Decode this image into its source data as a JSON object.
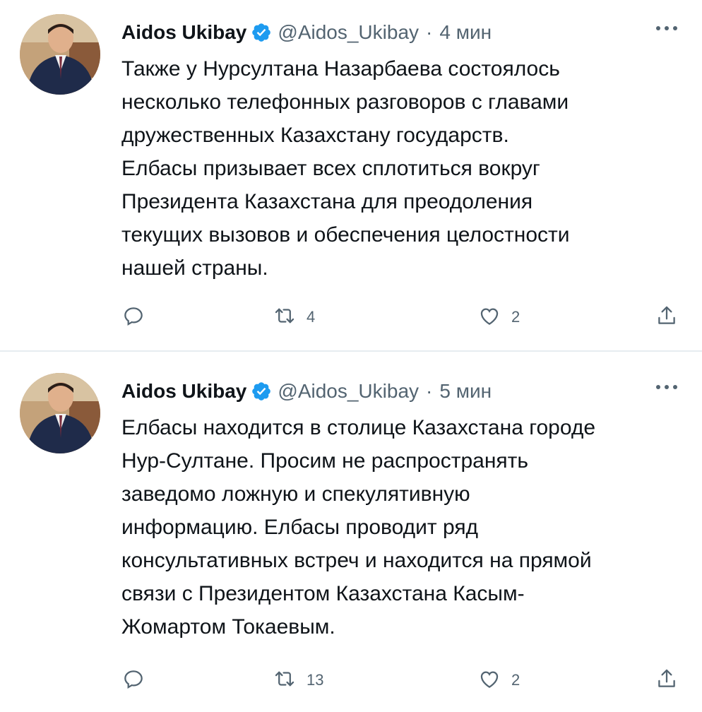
{
  "colors": {
    "text": "#0f1419",
    "muted": "#536471",
    "verified": "#1d9bf0",
    "divider": "#e6ecf0"
  },
  "tweets": [
    {
      "author_name": "Aidos Ukibay",
      "handle": "@Aidos_Ukibay",
      "separator": "·",
      "time": "4 мин",
      "text_lines": [
        "Также у Нурсултана Назарбаева состоялось",
        "несколько телефонных разговоров с главами",
        "дружественных Казахстану государств.",
        "Елбасы призывает всех сплотиться вокруг",
        "Президента Казахстана для преодоления",
        "текущих вызовов и обеспечения целостности",
        "нашей страны."
      ],
      "retweets": "4",
      "likes": "2",
      "icons": [
        "reply-icon",
        "retweet-icon",
        "like-icon",
        "share-icon",
        "more-icon"
      ]
    },
    {
      "author_name": "Aidos Ukibay",
      "handle": "@Aidos_Ukibay",
      "separator": "·",
      "time": "5 мин",
      "text_lines": [
        "Елбасы находится в столице Казахстана городе",
        "Нур-Султане. Просим не распространять",
        "заведомо ложную и спекулятивную",
        "информацию. Елбасы проводит ряд",
        "консультативных встреч и находится на прямой",
        "связи с Президентом Казахстана Касым-",
        "Жомартом Токаевым."
      ],
      "retweets": "13",
      "likes": "2",
      "icons": [
        "reply-icon",
        "retweet-icon",
        "like-icon",
        "share-icon",
        "more-icon"
      ]
    }
  ]
}
